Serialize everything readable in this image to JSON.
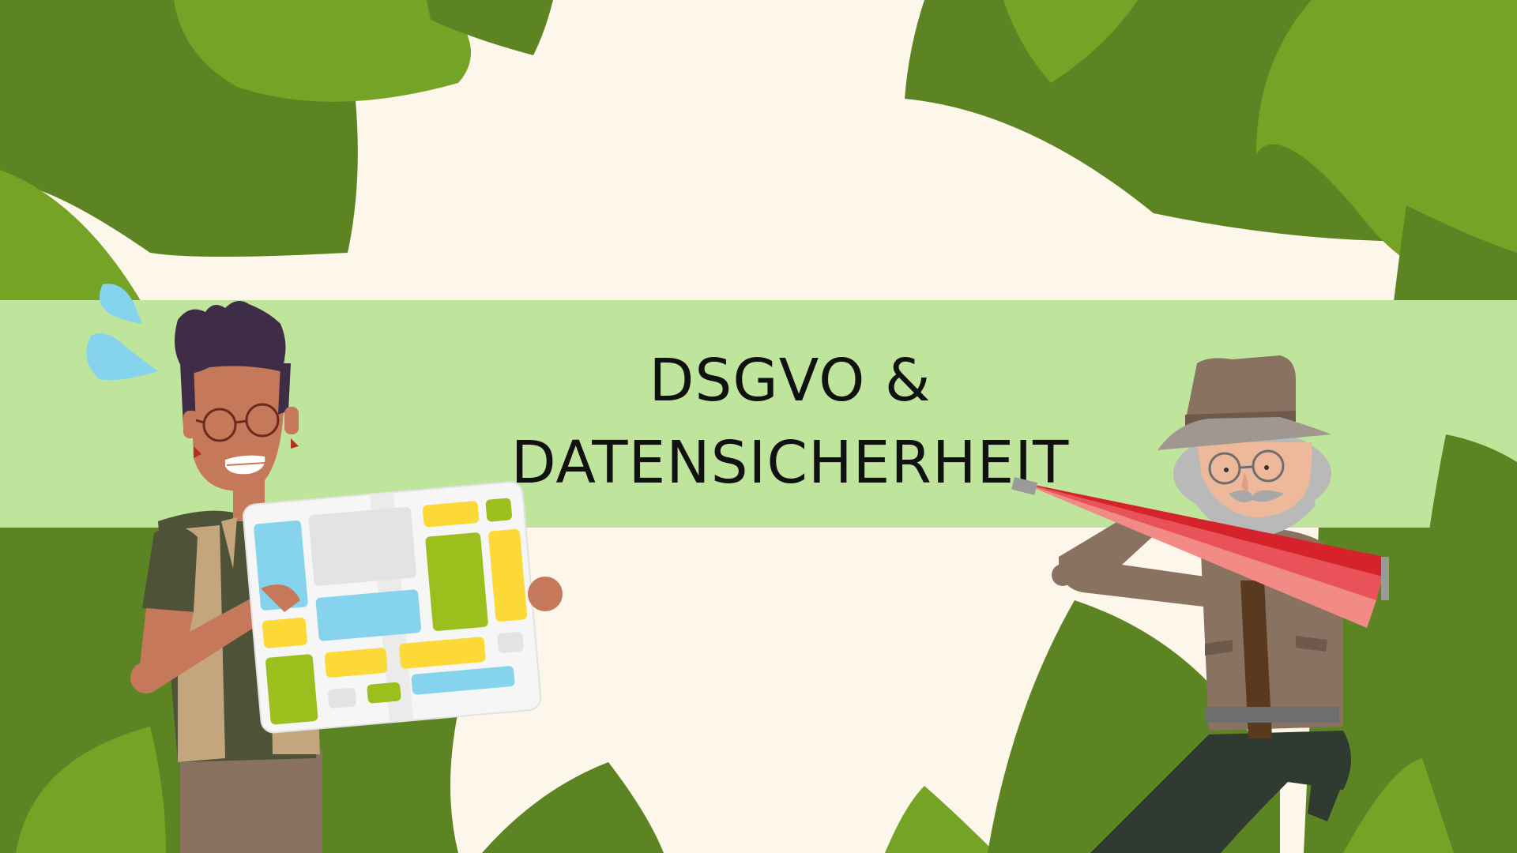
{
  "slide": {
    "title_line_1": "DSGVO &",
    "title_line_2": "DATENSICHERHEIT"
  },
  "colors": {
    "background": "#fdf6ea",
    "banner": "#bfe59c",
    "leaf_dark": "#5d8423",
    "leaf_light": "#75a325",
    "title_text": "#111111"
  },
  "illustrations": {
    "left_character": "explorer-holding-map",
    "right_character": "old-explorer-with-telescope",
    "foliage": "jungle-leaves"
  }
}
